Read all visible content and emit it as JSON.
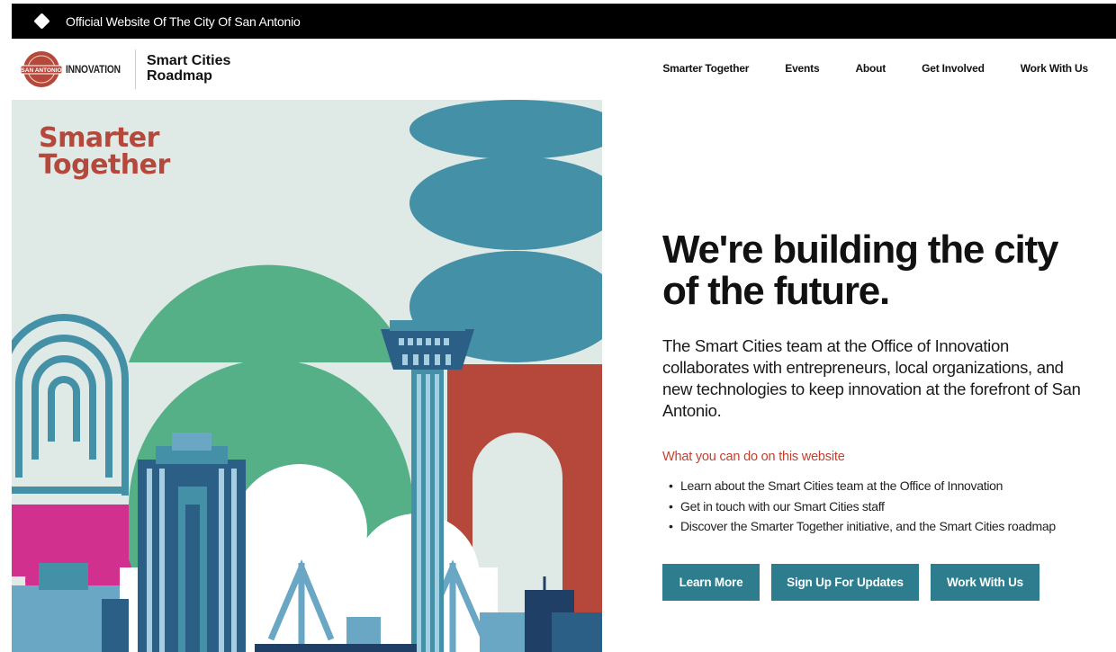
{
  "top_bar": {
    "text": "Official Website Of The City Of San Antonio",
    "icon": "diamond-icon"
  },
  "header": {
    "seal_text": "SAN ANTONIO",
    "department": "INNOVATION",
    "site_title_line1": "Smart Cities",
    "site_title_line2": "Roadmap",
    "nav": [
      "Smarter Together",
      "Events",
      "About",
      "Get Involved",
      "Work With Us"
    ]
  },
  "illustration": {
    "logo_line1": "Smarter",
    "logo_line2": "Together"
  },
  "hero": {
    "headline": "We're building the city of the future.",
    "intro": "The Smart Cities team at the Office of Innovation collaborates with entrepreneurs, local organizations, and new technologies to keep innovation at the forefront of San Antonio.",
    "section_label": "What you can do on this website",
    "bullets": [
      "Learn about the Smart Cities team at the Office of Innovation",
      "Get in touch with our Smart Cities staff",
      "Discover the Smarter Together initiative, and the Smart Cities roadmap"
    ],
    "buttons": [
      "Learn More",
      "Sign Up For Updates",
      "Work With Us"
    ]
  },
  "colors": {
    "accent": "#2e7d8f",
    "brand_red": "#b5473b",
    "label_red": "#c2412f",
    "green": "#55b088",
    "teal": "#4390a7",
    "magenta": "#d1308e"
  }
}
